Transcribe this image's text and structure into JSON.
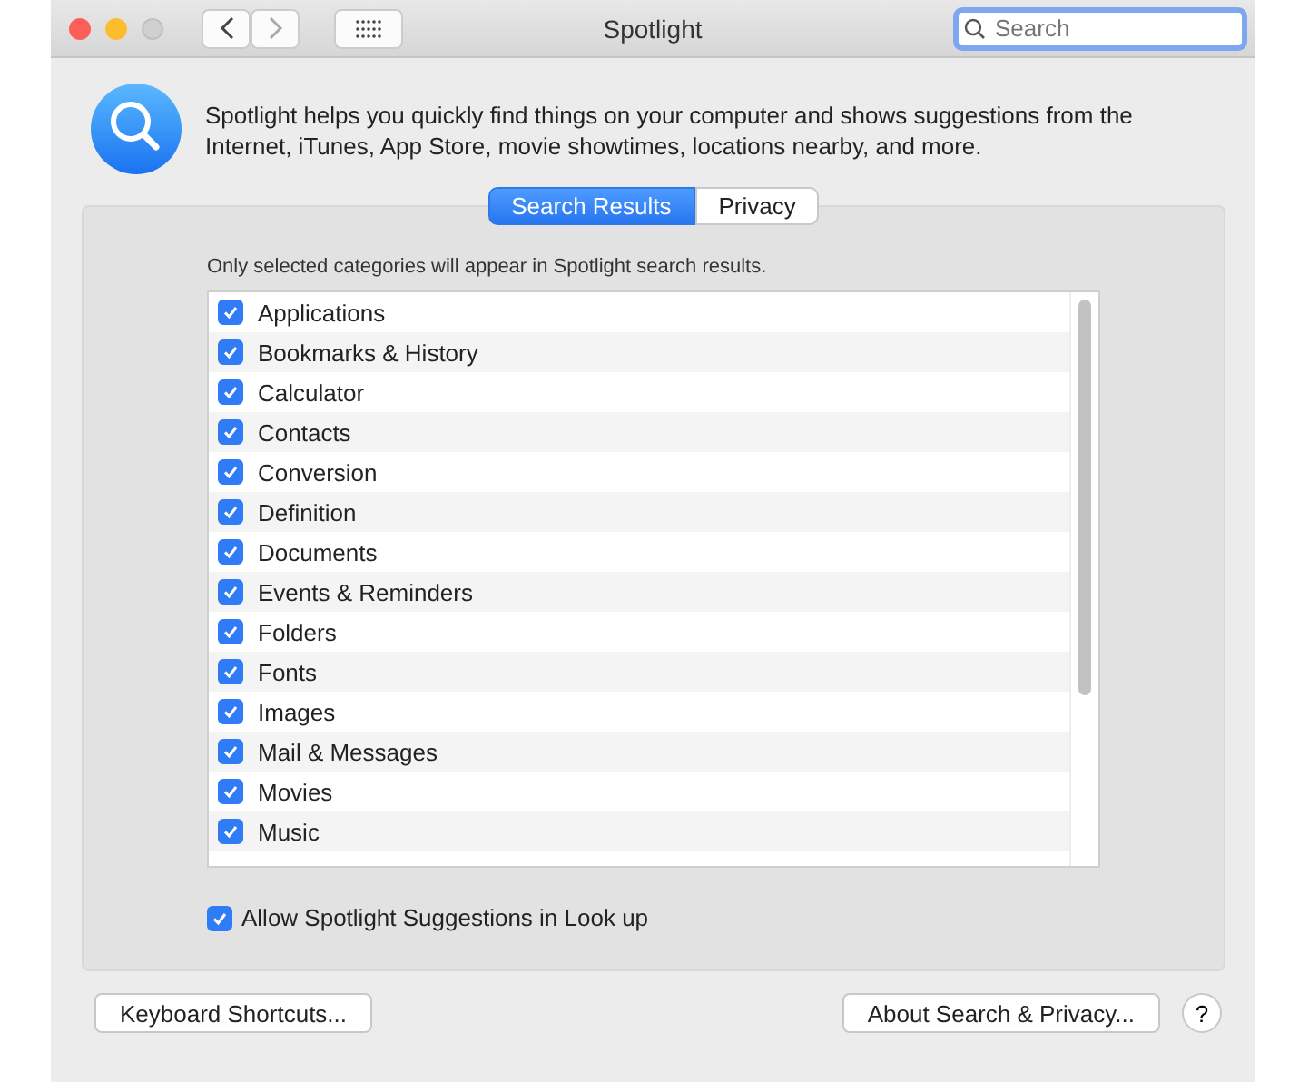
{
  "window": {
    "title": "Spotlight",
    "search": {
      "placeholder": "Search"
    }
  },
  "intro": "Spotlight helps you quickly find things on your computer and shows suggestions from the Internet, iTunes, App Store, movie showtimes, locations nearby, and more.",
  "tabs": [
    {
      "label": "Search Results",
      "selected": true
    },
    {
      "label": "Privacy",
      "selected": false
    }
  ],
  "instruction": "Only selected categories will appear in Spotlight search results.",
  "categories": [
    {
      "label": "Applications",
      "checked": true
    },
    {
      "label": "Bookmarks & History",
      "checked": true
    },
    {
      "label": "Calculator",
      "checked": true
    },
    {
      "label": "Contacts",
      "checked": true
    },
    {
      "label": "Conversion",
      "checked": true
    },
    {
      "label": "Definition",
      "checked": true
    },
    {
      "label": "Documents",
      "checked": true
    },
    {
      "label": "Events & Reminders",
      "checked": true
    },
    {
      "label": "Folders",
      "checked": true
    },
    {
      "label": "Fonts",
      "checked": true
    },
    {
      "label": "Images",
      "checked": true
    },
    {
      "label": "Mail & Messages",
      "checked": true
    },
    {
      "label": "Movies",
      "checked": true
    },
    {
      "label": "Music",
      "checked": true
    }
  ],
  "suggestions": {
    "label": "Allow Spotlight Suggestions in Look up",
    "checked": true
  },
  "buttons": {
    "left": "Keyboard Shortcuts...",
    "right": "About Search & Privacy...",
    "help": "?"
  }
}
